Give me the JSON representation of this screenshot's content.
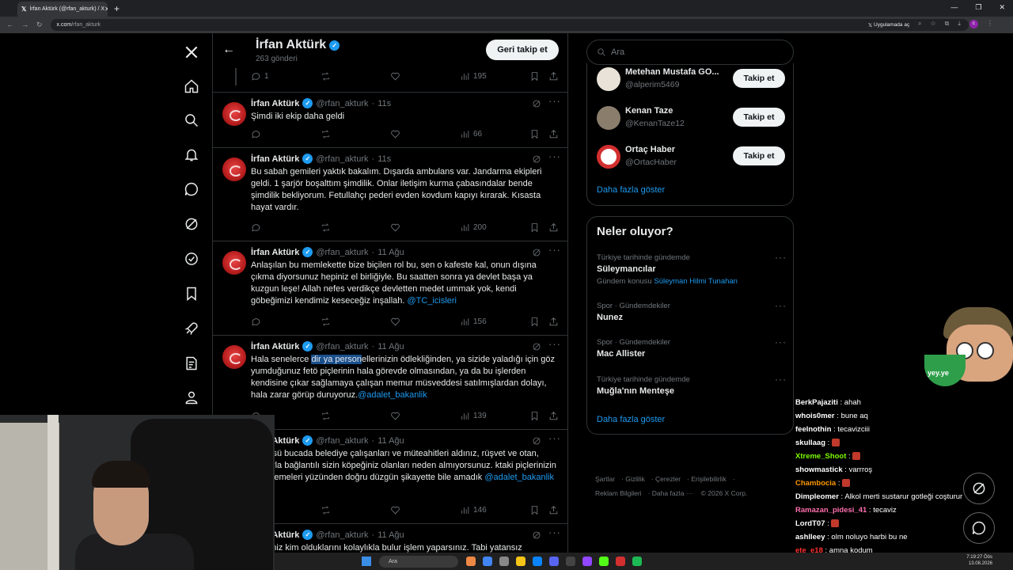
{
  "browser": {
    "tab_title": "İrfan Aktürk (@rfan_akturk) / X",
    "url_host": "x.com",
    "url_path": "/rfan_akturk",
    "open_app": "Uygulamada aç"
  },
  "profile_header": {
    "name": "İrfan Aktürk",
    "post_count": "263 gönderi",
    "follow_back": "Geri takip et"
  },
  "top_partial_actions": {
    "replies": "1",
    "views": "195"
  },
  "tweets": [
    {
      "name": "İrfan Aktürk",
      "handle": "@rfan_akturk",
      "time": "11s",
      "text": "Şimdi iki ekip daha geldi",
      "mention": "",
      "replies": "",
      "retweets": "",
      "likes": "",
      "views": "66"
    },
    {
      "name": "İrfan Aktürk",
      "handle": "@rfan_akturk",
      "time": "11s",
      "text": "Bu sabah gemileri yaktık bakalım. Dışarda ambulans var. Jandarma ekipleri geldi. 1 şarjör boşalttım şimdilik. Onlar iletişim kurma çabasındalar bende şimdilik bekliyorum. Fetullahçı pederi evden kovdum kapıyı kırarak. Kısasta hayat vardır.",
      "mention": "",
      "views": "200"
    },
    {
      "name": "İrfan Aktürk",
      "handle": "@rfan_akturk",
      "time": "11 Ağu",
      "text": "Anlaşılan bu memlekette bize biçilen rol bu, sen o kafeste kal, onun dışına çıkma diyorsunuz hepiniz el birliğiyle. Bu saatten sonra ya devlet başa ya kuzgun leşe! Allah nefes verdikçe devletten medet ummak yok, kendi göbeğimizi kendimiz keseceğiz inşallah. ",
      "mention": "@TC_icisleri",
      "views": "156"
    },
    {
      "name": "İrfan Aktürk",
      "handle": "@rfan_akturk",
      "time": "11 Ağu",
      "text_before": "Hala senelerce ",
      "text_sel": "dir ya person",
      "text_after": "ellerinizin ödlekliğinden, ya sizide yaladığı için göz yumduğunuz fetö piçlerinin hala görevde olmasından, ya da bu işlerden kendisine çıkar sağlamaya çalışan memur müsveddesi satılmışlardan dolayı, hala zarar görüp duruyoruz.",
      "mention": "@adalet_bakanlik",
      "views": "139"
    },
    {
      "name": "İrfan Aktürk",
      "handle": "@rfan_akturk",
      "time": "11 Ağu",
      "text": "t sürüsü bucada belediye çalışanları ve müteahitleri aldınız, rüşvet ve otan, bunlarla bağlantılı sizin köpeğiniz olanları neden almıyorsunuz. ktaki piçlerinizin engellemeleri yüzünden doğru düzgün şikayette bile amadık ",
      "mention": "@adalet_bakanlik",
      "views": "146"
    },
    {
      "name": "İrfan Aktürk",
      "handle": "@rfan_akturk",
      "time": "11 Ağu",
      "text": "steseniz kim olduklarını kolaylıkla bulur işlem yaparsınız. Tabi yatansız",
      "mention": "",
      "views": ""
    }
  ],
  "search": {
    "placeholder": "Ara"
  },
  "who_to_follow": [
    {
      "name": "Metehan Mustafa GO...",
      "handle": "@alperim5469",
      "button": "Takip et"
    },
    {
      "name": "Kenan Taze",
      "handle": "@KenanTaze12",
      "button": "Takip et"
    },
    {
      "name": "Ortaç Haber",
      "handle": "@OrtacHaber",
      "button": "Takip et"
    }
  ],
  "show_more": "Daha fazla göster",
  "trends": {
    "title": "Neler oluyor?",
    "items": [
      {
        "context": "Türkiye tarihinde gündemde",
        "topic": "Süleymancılar",
        "sub_label": "Gündem konusu ",
        "sub_link": "Süleyman Hilmi Tunahan"
      },
      {
        "context": "Spor · Gündemdekiler",
        "topic": "Nunez"
      },
      {
        "context": "Spor · Gündemdekiler",
        "topic": "Mac Allister"
      },
      {
        "context": "Türkiye tarihinde gündemde",
        "topic": "Muğla'nın Menteşe"
      }
    ],
    "show_more": "Daha fazla göster"
  },
  "footer": {
    "links": [
      "Şartlar",
      "Gizlilik",
      "Çerezler",
      "Erişilebilirlik",
      "Reklam Bilgileri",
      "Daha fazla ···"
    ],
    "copyright": "© 2026 X Corp."
  },
  "chat": [
    {
      "user": "BerkPajaziti",
      "color": "#ffffff",
      "msg": "ahah"
    },
    {
      "user": "whois0mer",
      "color": "#ffffff",
      "msg": "bune aq"
    },
    {
      "user": "feelnothin",
      "color": "#ffffff",
      "msg": "tecavizciii"
    },
    {
      "user": "skullaag",
      "color": "#ffffff",
      "msg": "",
      "emote": true
    },
    {
      "user": "Xtreme_Shoot",
      "color": "#7CFC00",
      "msg": "",
      "emote": true
    },
    {
      "user": "showmastick",
      "color": "#ffffff",
      "msg": "varrroş"
    },
    {
      "user": "Chambocia",
      "color": "#ff9800",
      "msg": "",
      "emote": true
    },
    {
      "user": "Dimpleomer",
      "color": "#ffffff",
      "msg": "Alkol merti sustarur gotleği coşturur"
    },
    {
      "user": "Ramazan_pidesi_41",
      "color": "#ff6fae",
      "msg": "tecaviz"
    },
    {
      "user": "LordT07",
      "color": "#ffffff",
      "msg": "",
      "emote": true
    },
    {
      "user": "ashlleey",
      "color": "#ffffff",
      "msg": "olm noluyo harbi bu ne"
    },
    {
      "user": "ete_e18",
      "color": "#ff3030",
      "msg": "amna kodum"
    }
  ],
  "emote_label": "yey.ye",
  "taskbar": {
    "search": "Ara",
    "time": "7:19:27 Öös",
    "date": "13.08.2026"
  },
  "colors": {
    "accent": "#1d9bf0",
    "bg": "#000000",
    "border": "#2f3336",
    "muted": "#71767b"
  }
}
